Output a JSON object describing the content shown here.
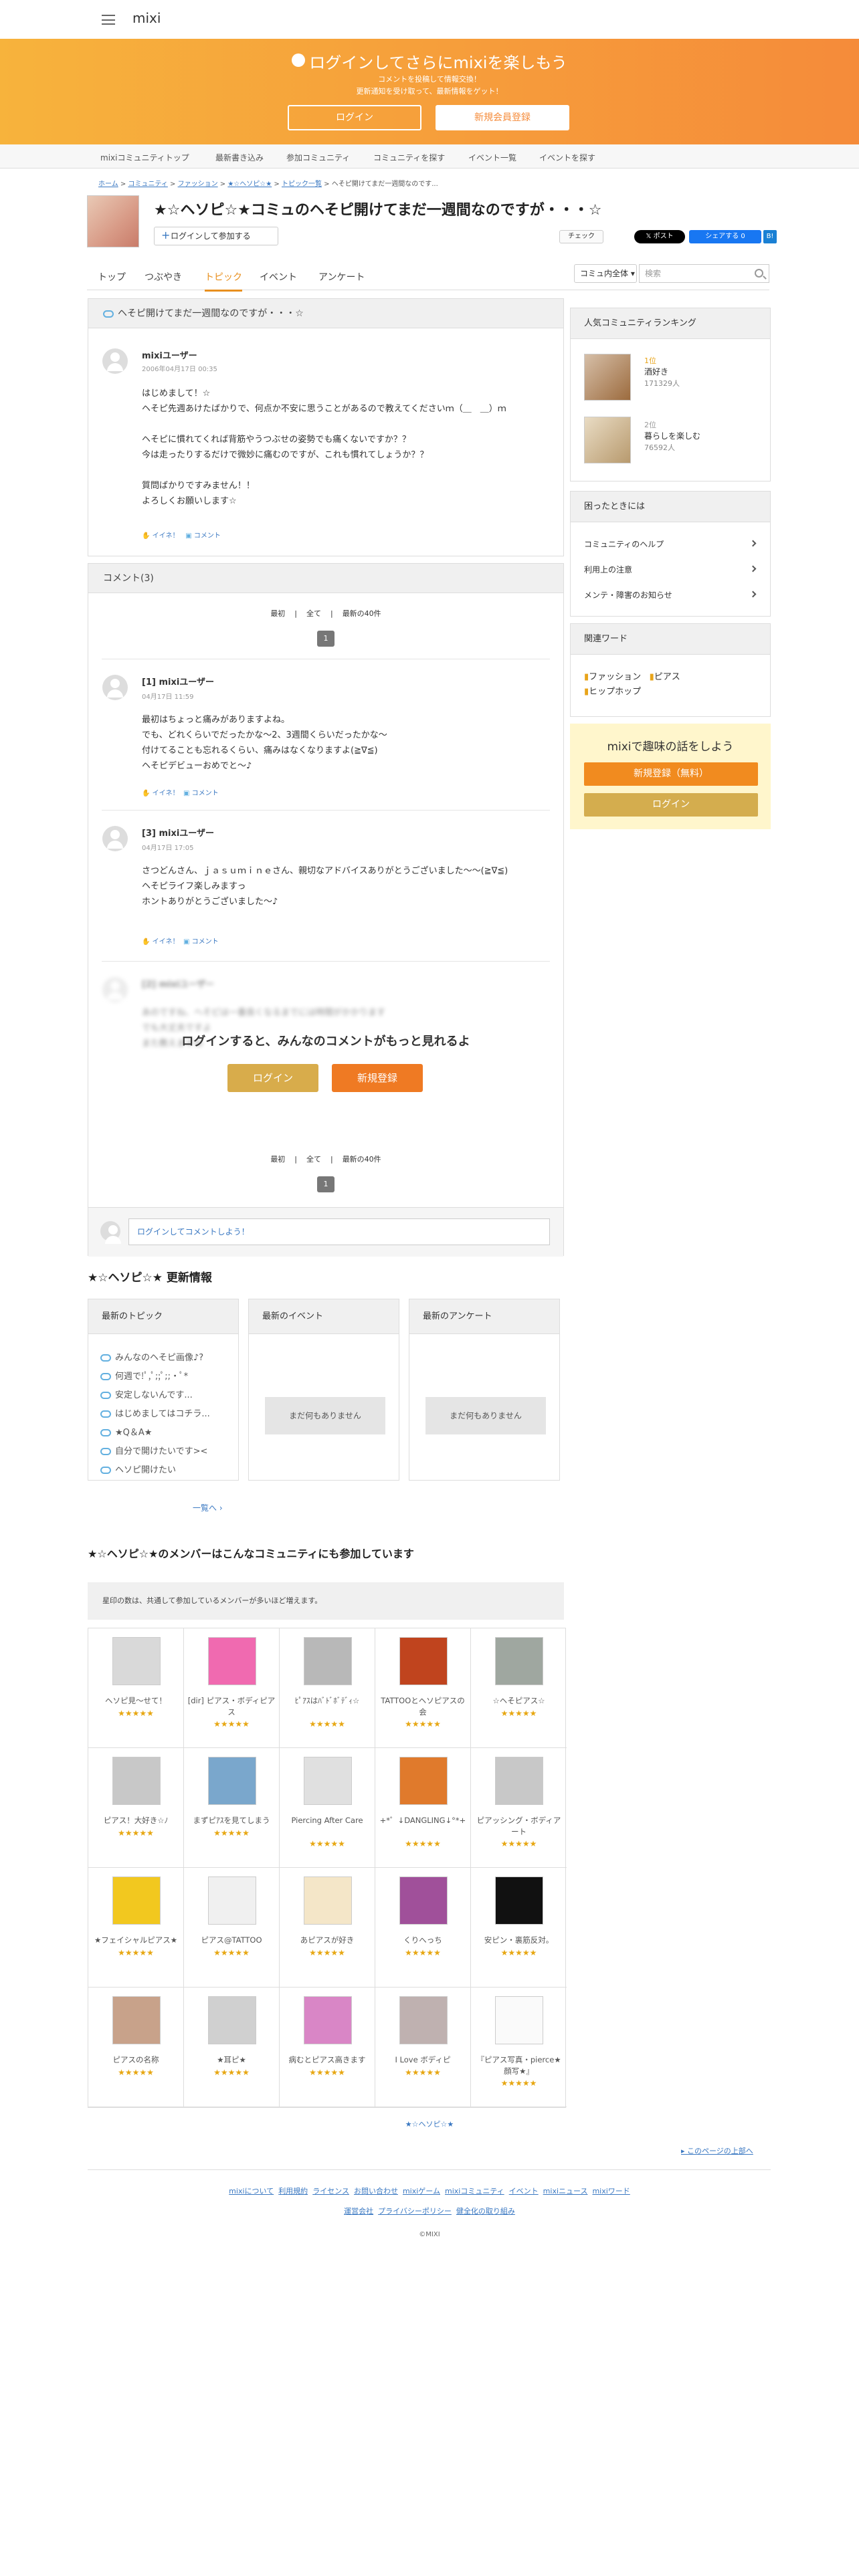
{
  "header": {
    "logo": "mixi"
  },
  "banner": {
    "title": "ログインしてさらにmixiを楽しもう",
    "sub1": "コメントを投稿して情報交換！",
    "sub2": "更新通知を受け取って、最新情報をゲット！",
    "login": "ログイン",
    "register": "新規会員登録"
  },
  "gnav": [
    "mixiコミュニティトップ",
    "最新書き込み",
    "参加コミュニティ",
    "コミュニティを探す",
    "イベント一覧",
    "イベントを探す"
  ],
  "breadcrumb": {
    "items": [
      "ホーム",
      "コミュニティ",
      "ファッション",
      "★☆ヘソピ☆★",
      "トピック一覧"
    ],
    "current": "ヘそピ開けてまだ一週間なのです..."
  },
  "community": {
    "title": "★☆ヘソピ☆★コミュのヘそピ開けてまだ一週間なのですが・・・☆",
    "join": "ログインして参加する",
    "check": "チェック",
    "x_post": "ポスト",
    "fb_share": "シェアする 0",
    "b": "B!"
  },
  "tabs": [
    "トップ",
    "つぶやき",
    "トピック",
    "イベント",
    "アンケート"
  ],
  "search": {
    "scope": "コミュ内全体",
    "placeholder": "検索"
  },
  "topic": {
    "title": "ヘそピ開けてまだ一週間なのですが・・・☆",
    "user": "mixiユーザー",
    "date": "2006年04月17日 00:35",
    "body": "はじめまして！☆\nヘそピ先週あけたばかりで、何点か不安に思うことがあるので教えてくださいｍ（＿　＿）ｍ\n\nヘそピに慣れてくれば背筋やうつぶせの姿勢でも痛くないですか？？\n今は走ったりするだけで微妙に痛むのですが、これも慣れてしょうか？？\n\n質問ばかりですみません！！\nよろしくお願いします☆",
    "like": "イイネ！",
    "comment": "コメント"
  },
  "comments": {
    "header": "コメント(3)",
    "nav_first": "最初",
    "nav_all": "全て",
    "nav_latest": "最新の40件",
    "page": "1",
    "items": [
      {
        "num": "[1] mixiユーザー",
        "date": "04月17日 11:59",
        "body": "最初はちょっと痛みがありますよね。\nでも、どれくらいでだったかな〜2、3週間くらいだったかな〜\n付けてることも忘れるくらい、痛みはなくなりますよ(≧∇≦)\nヘそピデビューおめでと〜♪"
      },
      {
        "num": "[3] mixiユーザー",
        "date": "04月17日 17:05",
        "body": "さつどんさん、ｊａｓｕｍｉｎｅさん、親切なアドバイスありがとうございました〜〜(≧∇≦)\nヘそピライフ楽しみますっ\nホントありがとうございました〜♪"
      },
      {
        "num": "[2] mixiユーザー",
        "date": "",
        "body": "あのですね、ヘそピは一番良くなるまでには時間がかかります\nでも大丈夫ですよ\nまた教えますね"
      }
    ],
    "login_prompt": "ログインすると、みんなのコメントがもっと見れるよ",
    "login": "ログイン",
    "register": "新規登録",
    "input_placeholder": "ログインしてコメントしよう！"
  },
  "ranking": {
    "title": "人気コミュニティランキング",
    "items": [
      {
        "rank": "1位",
        "name": "酒好き",
        "count": "171329人"
      },
      {
        "rank": "2位",
        "name": "暮らしを楽しむ",
        "count": "76592人"
      }
    ]
  },
  "help": {
    "title": "困ったときには",
    "items": [
      "コミュニティのヘルプ",
      "利用上の注意",
      "メンテ・障害のお知らせ"
    ]
  },
  "related": {
    "title": "関連ワード",
    "tags": [
      "ファッション",
      "ピアス",
      "ヒップホップ"
    ]
  },
  "cta": {
    "title": "mixiで趣味の話をしよう",
    "register": "新規登録（無料）",
    "login": "ログイン"
  },
  "updates": {
    "title": "★☆ヘソピ☆★ 更新情報",
    "cols": [
      "最新のトピック",
      "最新のイベント",
      "最新のアンケート"
    ],
    "topics": [
      "みんなのヘそピ画像♪?",
      "何週で!ﾟ,ﾟ;;ﾟ;;・ﾟ*",
      "安定しないんです...",
      "はじめましてはコチラ...",
      "★Q＆A★",
      "自分で開けたいです><",
      "ヘソピ開けたい"
    ],
    "more": "一覧へ",
    "no_items": "まだ何もありません"
  },
  "members": {
    "title": "★☆ヘソピ☆★のメンバーはこんなコミュニティにも参加しています",
    "note": "星印の数は、共通して参加しているメンバーが多いほど増えます。",
    "items": [
      "ヘソピ見〜せて！",
      "[dir] ピアス・ボディピアス",
      "ﾋﾟｱｽはﾊﾞﾄﾞﾎﾞﾃﾞｨ☆",
      "TATTOOとヘソピアスの会",
      "☆ヘそピアス☆",
      "ピアス！大好き☆ﾉ",
      "まずピｱｽを見てしまう",
      "Piercing After Care",
      "+*゜↓DANGLING↓°*+",
      "ピアッシング・ボディアート",
      "★フェイシャルピアス★",
      "ピアス@TATTOO",
      "あピアスが好き",
      "くりへっち",
      "安ピン・裏筋反対。",
      "ピアスの名称",
      "★耳ピ★",
      "病むとピアス高きます",
      "I Love ボディピ",
      "『ピアス写真・pierce★顔写★』"
    ],
    "stars": "★★★★★"
  },
  "footer": {
    "community_link": "★☆ヘソピ☆★",
    "pagetop": "このページの上部へ",
    "links1": [
      "mixiについて",
      "利用規約",
      "ライセンス",
      "お問い合わせ",
      "mixiゲーム",
      "mixiコミュニティ",
      "イベント",
      "mixiニュース",
      "mixiワード"
    ],
    "links2": [
      "運営会社",
      "プライバシーポリシー",
      "健全化の取り組み"
    ],
    "copyright": "©MIXI"
  }
}
